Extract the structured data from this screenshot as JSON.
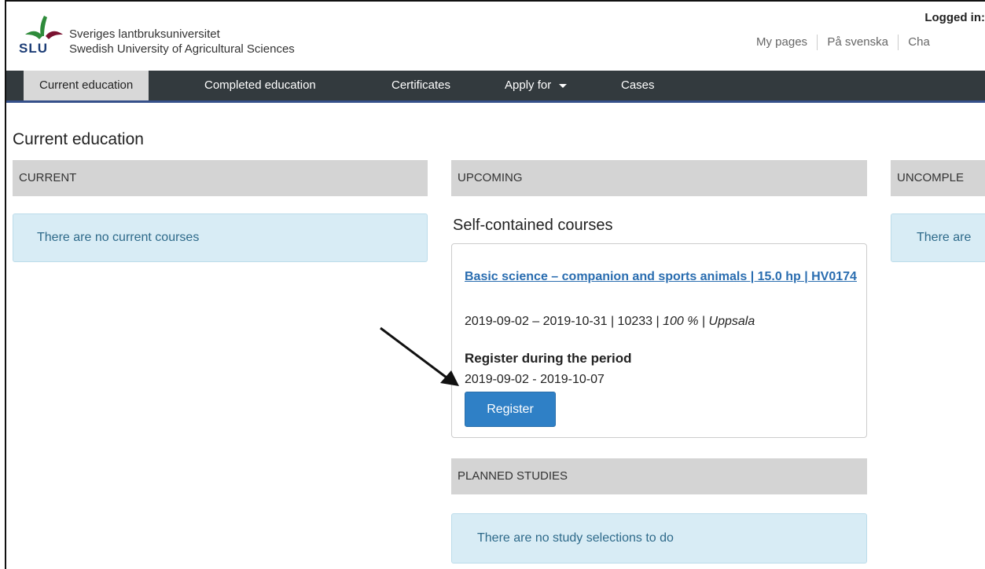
{
  "header": {
    "org_name_sv": "Sveriges lantbruksuniversitet",
    "org_name_en": "Swedish University of Agricultural Sciences",
    "logo_abbrev": "SLU",
    "logged_in": "Logged in:",
    "links": [
      "My pages",
      "På svenska",
      "Cha"
    ]
  },
  "nav": {
    "items": [
      {
        "label": "Current education",
        "active": true
      },
      {
        "label": "Completed education"
      },
      {
        "label": "Certificates"
      },
      {
        "label": "Apply for",
        "dropdown": true
      },
      {
        "label": "Cases"
      }
    ]
  },
  "main": {
    "title": "Current education",
    "current": {
      "header": "CURRENT",
      "empty_message": "There are no current courses"
    },
    "upcoming": {
      "header": "UPCOMING",
      "section_heading": "Self-contained courses",
      "course": {
        "title": "Basic science – companion and sports animals | 15.0 hp | HV0174",
        "dates": "2019-09-02 – 2019-10-31",
        "code": "10233",
        "pace": "100 %",
        "location": "Uppsala",
        "register_label": "Register during the period",
        "register_period": "2019-09-02 - 2019-10-07",
        "register_button": "Register"
      }
    },
    "planned": {
      "header": "PLANNED STUDIES",
      "empty_message": "There are no study selections to do"
    },
    "uncompleted": {
      "header": "UNCOMPLE",
      "empty_message": "There are"
    }
  },
  "colors": {
    "nav_bg": "#333a3e",
    "nav_active_bg": "#d8d8d8",
    "link": "#2a6db0",
    "button": "#2f80c6",
    "info_bg": "#d8ecf5"
  },
  "icons": [
    "slu-logo-icon",
    "chevron-down-icon",
    "annotation-arrow"
  ]
}
